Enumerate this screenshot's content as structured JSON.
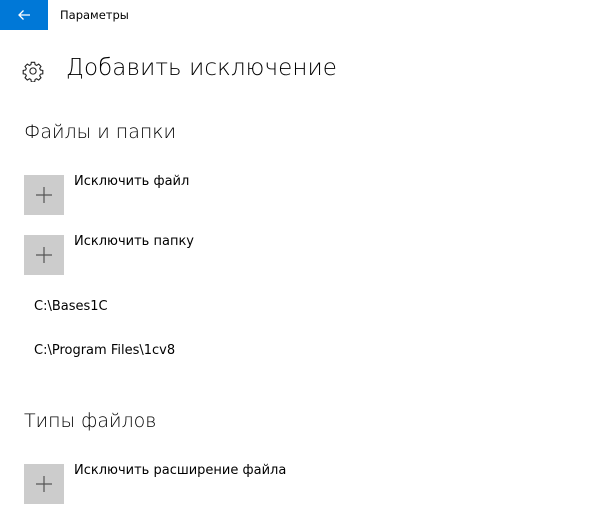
{
  "window": {
    "title": "Параметры",
    "accent_color": "#0078d7"
  },
  "header": {
    "icon": "gear-icon",
    "title": "Добавить исключение"
  },
  "sections": {
    "files_folders": {
      "heading": "Файлы и папки",
      "exclude_file_label": "Исключить файл",
      "exclude_folder_label": "Исключить папку",
      "excluded_paths": [
        "C:\\Bases1C",
        "C:\\Program Files\\1cv8"
      ]
    },
    "file_types": {
      "heading": "Типы файлов",
      "exclude_extension_label": "Исключить расширение файла"
    }
  },
  "icons": {
    "back": "back-arrow-icon",
    "add": "plus-icon"
  },
  "colors": {
    "tile_background": "#cccccc"
  }
}
